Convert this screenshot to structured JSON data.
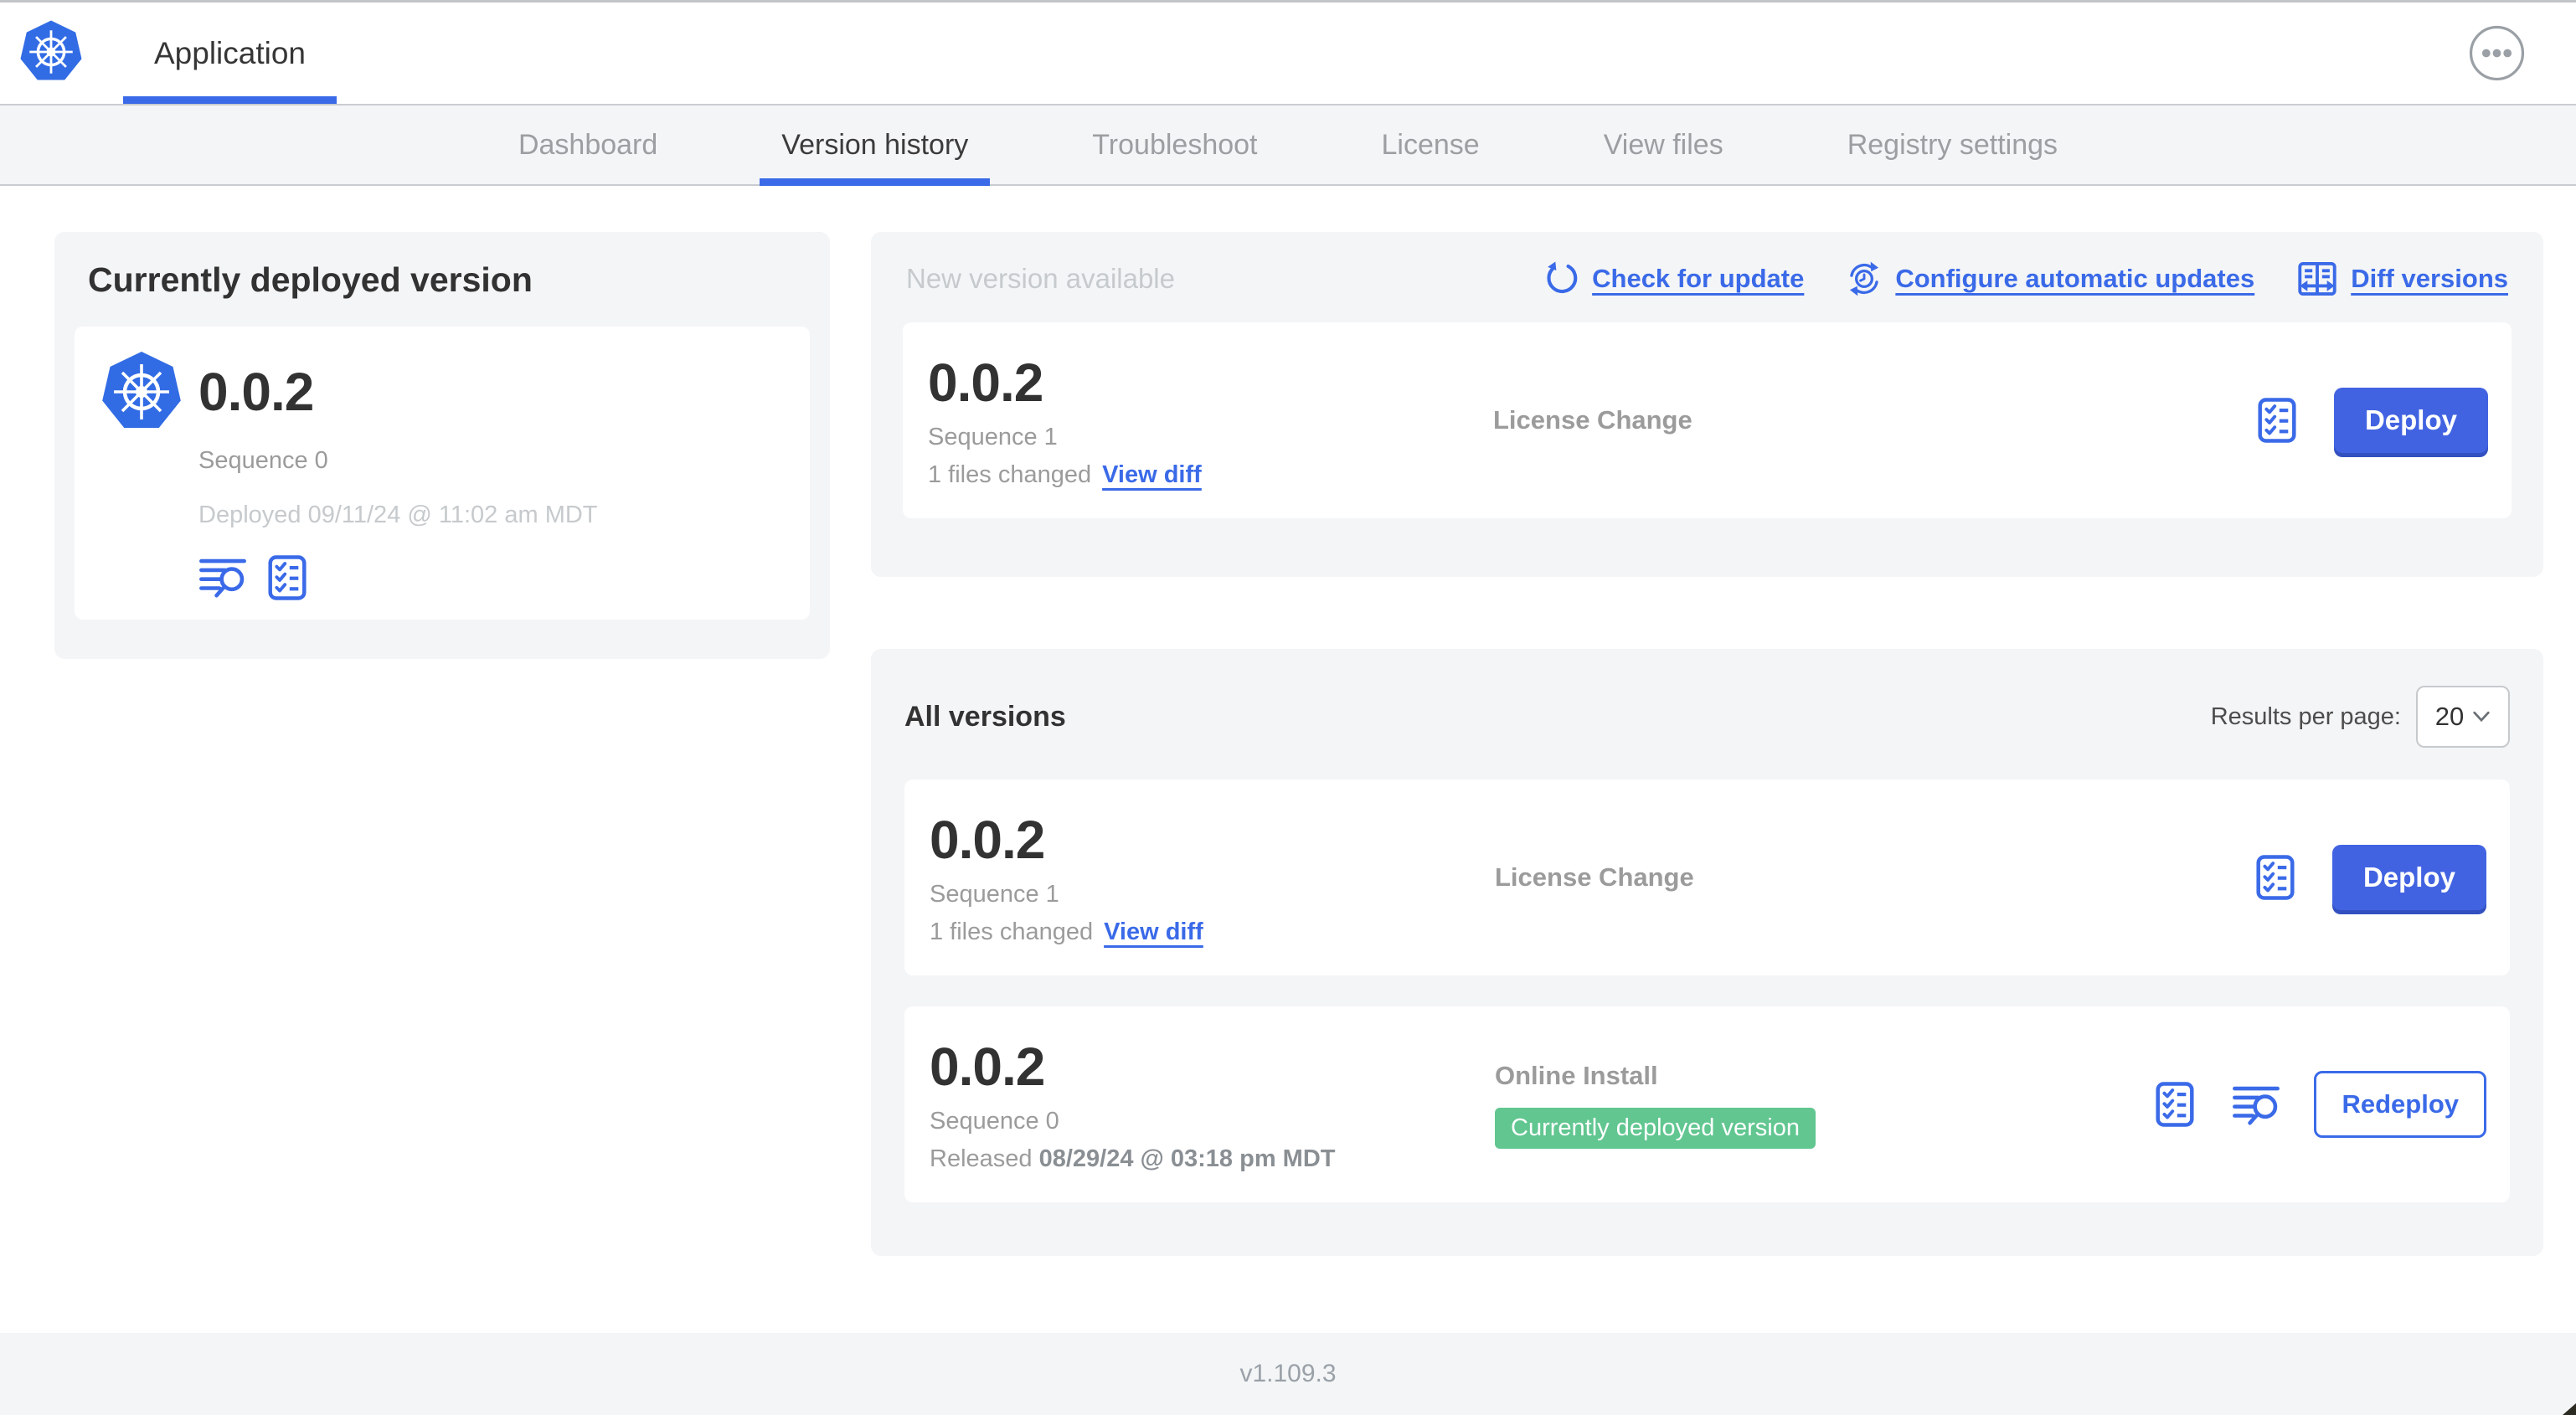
{
  "header": {
    "app_title": "Application"
  },
  "nav": {
    "tabs": [
      {
        "label": "Dashboard",
        "active": false
      },
      {
        "label": "Version history",
        "active": true
      },
      {
        "label": "Troubleshoot",
        "active": false
      },
      {
        "label": "License",
        "active": false
      },
      {
        "label": "View files",
        "active": false
      },
      {
        "label": "Registry settings",
        "active": false
      }
    ]
  },
  "current_version": {
    "heading": "Currently deployed version",
    "version": "0.0.2",
    "sequence": "Sequence 0",
    "deployed": "Deployed 09/11/24 @ 11:02 am MDT"
  },
  "new_version": {
    "heading": "New version available",
    "links": [
      {
        "label": "Check for update",
        "icon": "refresh-icon"
      },
      {
        "label": "Configure automatic updates",
        "icon": "clock-sync-icon"
      },
      {
        "label": "Diff versions",
        "icon": "diff-icon"
      }
    ],
    "row": {
      "version": "0.0.2",
      "sequence": "Sequence 1",
      "files_changed": "1 files changed",
      "view_diff": "View diff",
      "source": "License Change",
      "action": "Deploy"
    }
  },
  "all_versions": {
    "heading": "All versions",
    "results_per_page_label": "Results per page:",
    "results_per_page_value": "20",
    "rows": [
      {
        "version": "0.0.2",
        "sequence": "Sequence 1",
        "files_changed": "1 files changed",
        "view_diff": "View diff",
        "source": "License Change",
        "action": "Deploy"
      },
      {
        "version": "0.0.2",
        "sequence": "Sequence 0",
        "released_prefix": "Released",
        "released_date": "08/29/24 @ 03:18 pm MDT",
        "source": "Online Install",
        "badge": "Currently deployed version",
        "action": "Redeploy"
      }
    ]
  },
  "footer": {
    "app_version": "v1.109.3"
  },
  "colors": {
    "accent_blue": "#3a6ae8",
    "button_blue": "#4263e1",
    "kubernetes_blue": "#326ce5",
    "badge_green": "#61c690",
    "card_gray": "#f4f5f7"
  }
}
